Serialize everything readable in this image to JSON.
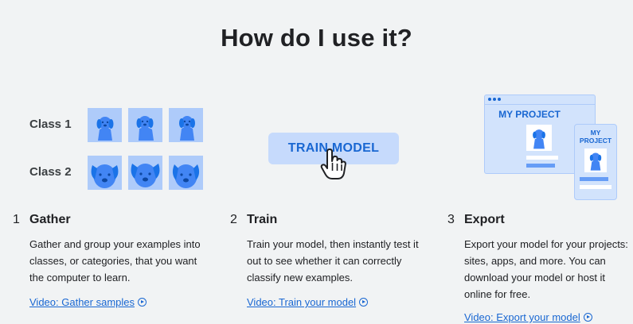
{
  "page": {
    "title": "How do I use it?"
  },
  "illustrations": {
    "gather": {
      "class_labels": [
        "Class 1",
        "Class 2"
      ]
    },
    "train": {
      "button_label": "TRAIN MODEL"
    },
    "export": {
      "window_title": "MY PROJECT",
      "phone_title_line1": "MY",
      "phone_title_line2": "PROJECT"
    }
  },
  "steps": [
    {
      "number": "1",
      "title": "Gather",
      "description": "Gather and group your examples into classes, or categories, that you want the computer to learn.",
      "link": "Video: Gather samples"
    },
    {
      "number": "2",
      "title": "Train",
      "description": "Train your model, then instantly test it out to see whether it can correctly classify new examples.",
      "link": "Video: Train your model"
    },
    {
      "number": "3",
      "title": "Export",
      "description": "Export your model for your projects: sites, apps, and more. You can download your model or host it online for free.",
      "link": "Video: Export your model"
    }
  ],
  "colors": {
    "accent": "#1967d2",
    "thumb_bg": "#aecbfa",
    "dog": "#4285f4",
    "background": "#f1f3f4"
  }
}
